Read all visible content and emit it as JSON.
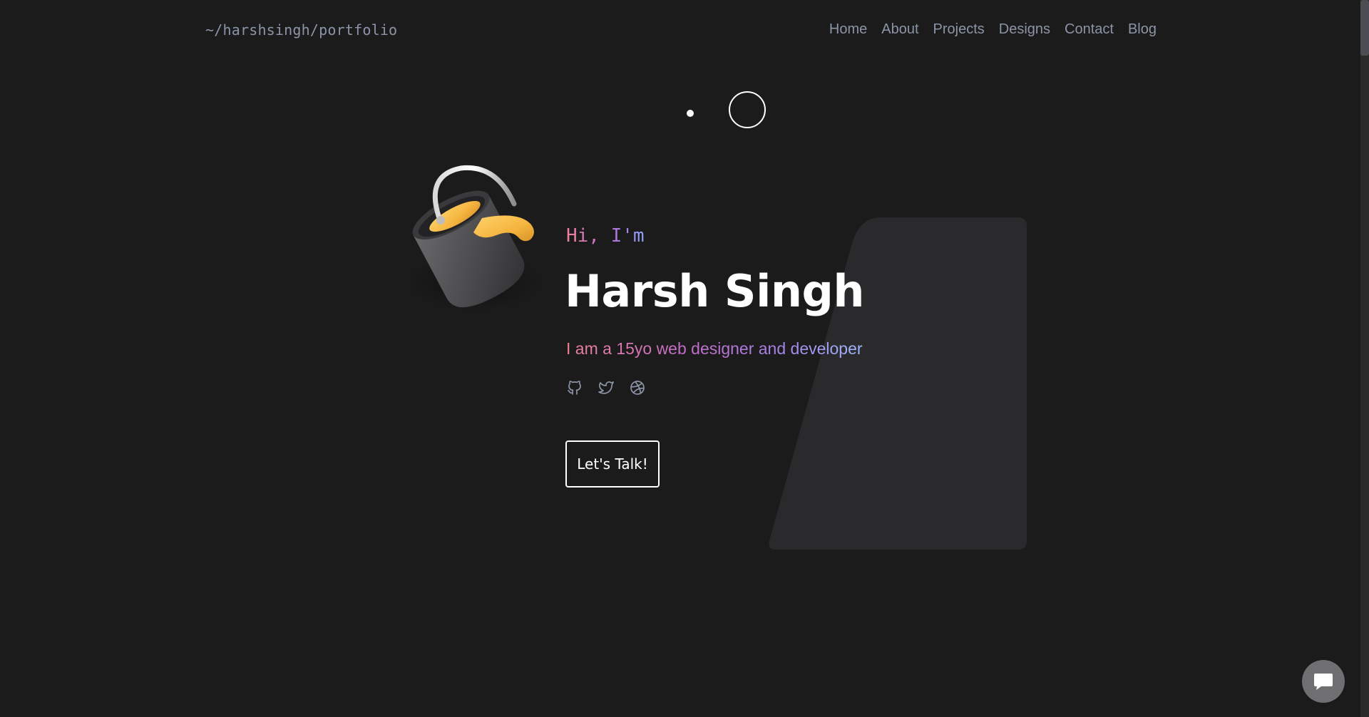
{
  "header": {
    "brand": "~/harshsingh/portfolio",
    "nav": [
      {
        "label": "Home"
      },
      {
        "label": "About"
      },
      {
        "label": "Projects"
      },
      {
        "label": "Designs"
      },
      {
        "label": "Contact"
      },
      {
        "label": "Blog"
      }
    ]
  },
  "hero": {
    "greeting": "Hi, I'm",
    "name": "Harsh Singh",
    "tagline": "I am a 15yo web designer and developer",
    "cta_label": "Let's Talk!",
    "socials": [
      {
        "icon": "github-icon"
      },
      {
        "icon": "twitter-icon"
      },
      {
        "icon": "dribbble-icon"
      }
    ]
  },
  "colors": {
    "background": "#1b1b1b",
    "nav_text": "#8b95a7",
    "card": "#2a2a2c",
    "gradient_start": "#f0829a",
    "gradient_mid": "#b66bd6",
    "gradient_end": "#8fa4ff",
    "paint": "#f5b53f"
  },
  "chat": {
    "icon": "chat-bubble-icon"
  }
}
